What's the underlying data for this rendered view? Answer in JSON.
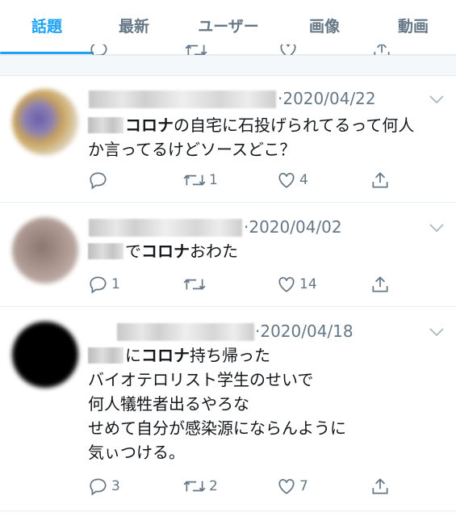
{
  "tabs": [
    {
      "label": "話題",
      "active": true
    },
    {
      "label": "最新",
      "active": false
    },
    {
      "label": "ユーザー",
      "active": false
    },
    {
      "label": "画像",
      "active": false
    },
    {
      "label": "動画",
      "active": false
    }
  ],
  "colors": {
    "accent": "#1da1f2",
    "secondary_text": "#657786",
    "primary_text": "#14171a",
    "border": "#e6ecf0"
  },
  "tweets": [
    {
      "date": "·2020/04/22",
      "lines": [
        {
          "before": "",
          "bold": "コロナ",
          "after": "の自宅に石投げられてるって何人",
          "mention": true
        },
        {
          "before": "か言ってるけどソースどこ？",
          "bold": "",
          "after": "",
          "mention": false
        }
      ],
      "reply_count": "",
      "retweet_count": "1",
      "like_count": "4"
    },
    {
      "date": "·2020/04/02",
      "lines": [
        {
          "before": "で",
          "bold": "コロナ",
          "after": "おわた",
          "mention": true
        }
      ],
      "reply_count": "1",
      "retweet_count": "",
      "like_count": "14"
    },
    {
      "date": "·2020/04/18",
      "lines": [
        {
          "before": "に",
          "bold": "コロナ",
          "after": "持ち帰った",
          "mention": true
        },
        {
          "before": "バイオテロリスト学生のせいで",
          "bold": "",
          "after": "",
          "mention": false
        },
        {
          "before": "何人犠牲者出るやろな",
          "bold": "",
          "after": "",
          "mention": false
        },
        {
          "before": "せめて自分が感染源にならんように",
          "bold": "",
          "after": "",
          "mention": false
        },
        {
          "before": "気ぃつける。",
          "bold": "",
          "after": "",
          "mention": false
        }
      ],
      "reply_count": "3",
      "retweet_count": "2",
      "like_count": "7"
    }
  ],
  "icons": {
    "reply": "reply-icon",
    "retweet": "retweet-icon",
    "like": "heart-icon",
    "share": "share-icon",
    "caret": "chevron-down-icon"
  }
}
